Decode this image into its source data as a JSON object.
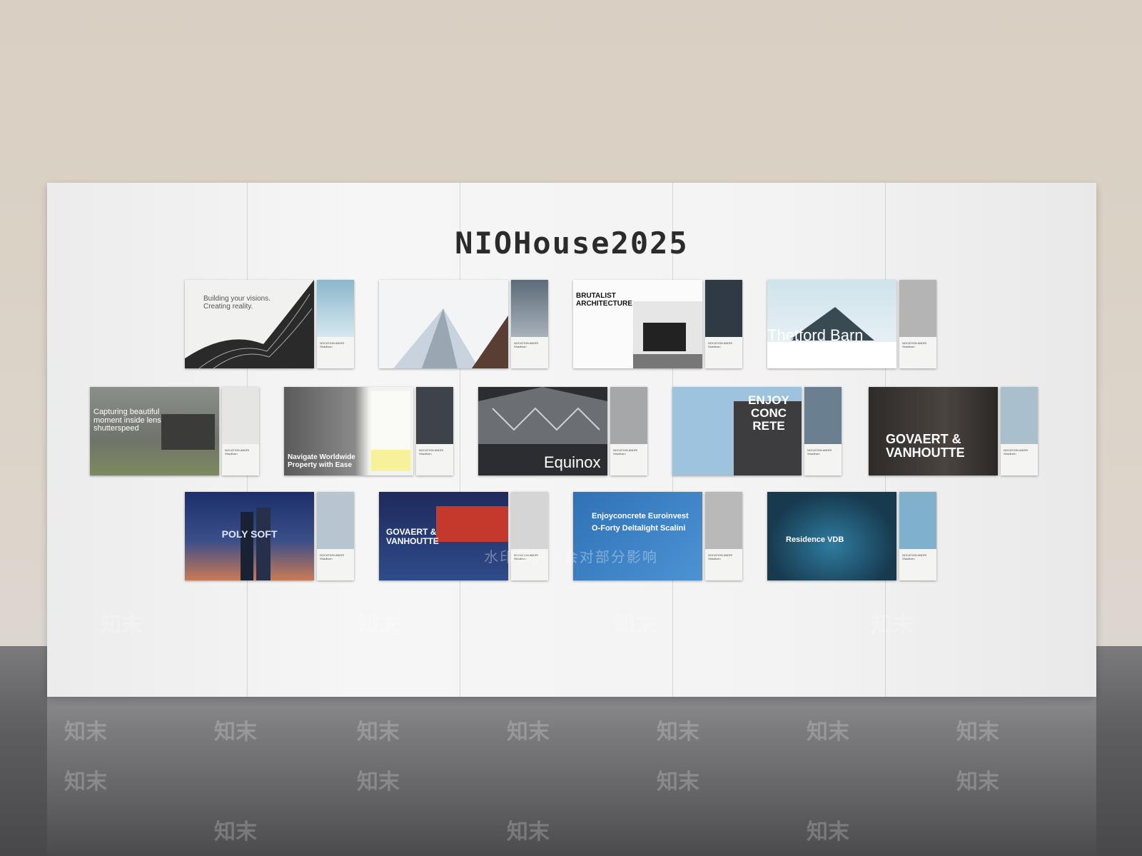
{
  "title": "NIOHouse2025",
  "side_caption": "NOCATION ANDRI Stradburn",
  "watermark": "知末",
  "watermark_strip": "水印保护 · 会对部分影响",
  "panels": [
    {
      "headline": "Building your visions. Creating reality.",
      "main_color": "#f1f1ef",
      "side_color": "#9fc6d7"
    },
    {
      "headline": "",
      "main_color": "#f3f4f6",
      "side_color": "#5d6a78"
    },
    {
      "headline": "BRUTALIST ARCHITECTURE",
      "main_color": "#fbfbfb",
      "side_color": "#2f3a44"
    },
    {
      "headline": "Thetford Barn",
      "main_color": "#cfe3ec",
      "side_color": "#b4b4b4"
    },
    {
      "headline": "Capturing beautiful moment inside lens and shutterspeed",
      "main_color": "#7a7f78",
      "side_color": "#e5e5e3"
    },
    {
      "headline": "Navigate Worldwide Property with Ease",
      "main_color": "#6f6f6f",
      "side_color": "#3d4348"
    },
    {
      "headline": "Equinox",
      "main_color": "#2b2d30",
      "side_color": "#a5a7a8"
    },
    {
      "headline": "ENJOY CONC RETE",
      "main_color": "#9dc3de",
      "side_color": "#6a7f90"
    },
    {
      "headline": "GOVAERT & VANHOUTTE",
      "main_color": "#3a3532",
      "side_color": "#a9c0cc"
    },
    {
      "headline": "POLY SOFT",
      "main_color": "#1c2f6b",
      "side_color": "#b6c5d0"
    },
    {
      "headline": "GOVAERT & VANHOUTTE",
      "main_color": "#1e2a5c",
      "side_color": "#d5d5d5"
    },
    {
      "headline": "Enjoyconcrete Euroinvest O-Forty Deltalight Scalini",
      "main_color": "#2f72b5",
      "side_color": "#b9b9b9"
    },
    {
      "headline": "Residence VDB",
      "main_color": "#173a4f",
      "side_color": "#7fb1cc"
    }
  ]
}
